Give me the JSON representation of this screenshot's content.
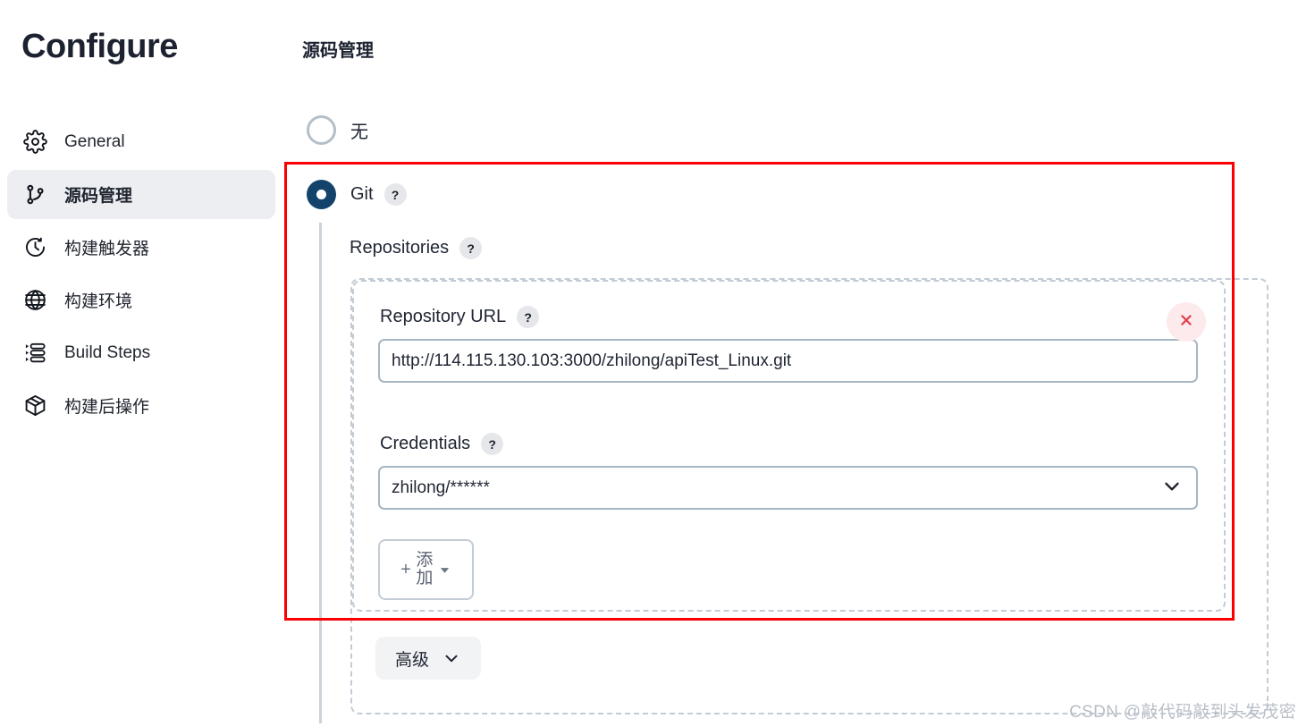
{
  "sidebar": {
    "title": "Configure",
    "items": [
      {
        "label": "General",
        "icon": "gear-icon",
        "active": false
      },
      {
        "label": "源码管理",
        "icon": "git-branch-icon",
        "active": true
      },
      {
        "label": "构建触发器",
        "icon": "clock-icon",
        "active": false
      },
      {
        "label": "构建环境",
        "icon": "globe-icon",
        "active": false
      },
      {
        "label": "Build Steps",
        "icon": "list-steps-icon",
        "active": false
      },
      {
        "label": "构建后操作",
        "icon": "package-box-icon",
        "active": false
      }
    ]
  },
  "main": {
    "section_title": "源码管理",
    "scm_options": [
      {
        "label": "无",
        "selected": false
      },
      {
        "label": "Git",
        "selected": true,
        "help": "?"
      }
    ],
    "git": {
      "repositories_label": "Repositories",
      "repositories_help": "?",
      "repository": {
        "url_label": "Repository URL",
        "url_help": "?",
        "url_value": "http://114.115.130.103:3000/zhilong/apiTest_Linux.git",
        "credentials_label": "Credentials",
        "credentials_help": "?",
        "credentials_value": "zhilong/******",
        "add_button_label": "添加",
        "add_button_plus": "+",
        "delete_button_label": "×"
      },
      "advanced_button_label": "高级"
    }
  },
  "watermark": "CSDN @敲代码敲到头发茂密",
  "colors": {
    "accent_selected_radio": "#13436a",
    "highlight_box": "#fb0000",
    "sidebar_active_bg": "#eceef2",
    "delete_bg": "#fdeaec",
    "delete_fg": "#e03e4e",
    "dashed_border": "#c3ccd4",
    "input_border": "#a8b6c1"
  }
}
